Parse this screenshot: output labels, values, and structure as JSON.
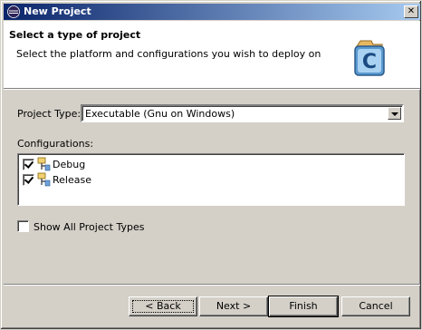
{
  "window": {
    "title": "New Project",
    "close_glyph": "✕"
  },
  "banner": {
    "title": "Select a type of project",
    "description": "Select the platform and configurations you wish to deploy on",
    "logo_letter": "C"
  },
  "project_type": {
    "label": "Project Type:",
    "selected": "Executable (Gnu on Windows)"
  },
  "configurations": {
    "label": "Configurations:",
    "items": [
      {
        "label": "Debug",
        "checked": true
      },
      {
        "label": "Release",
        "checked": true
      }
    ]
  },
  "show_all": {
    "label": "Show All Project Types",
    "checked": false
  },
  "buttons": {
    "back": "< Back",
    "next": "Next >",
    "finish": "Finish",
    "cancel": "Cancel"
  }
}
